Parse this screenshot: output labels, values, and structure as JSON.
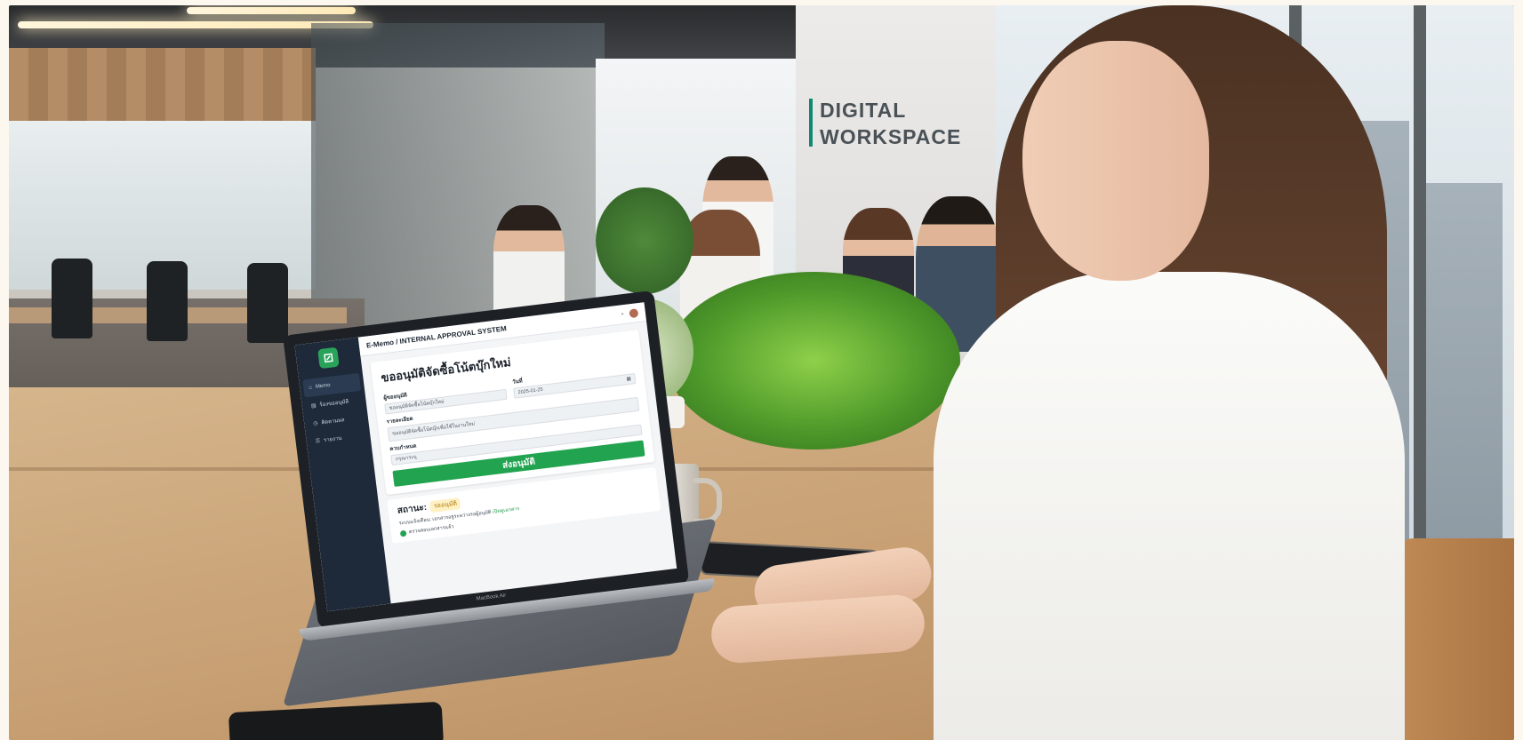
{
  "scene": {
    "wall_sign": {
      "line1": "DIGITAL",
      "line2": "WORKSPACE"
    }
  },
  "laptop": {
    "brand_label": "MacBook Air",
    "app": {
      "title": "E-Memo / INTERNAL APPROVAL SYSTEM",
      "sidebar": {
        "items": [
          {
            "label": "Memo",
            "icon": "home-icon",
            "active": true
          },
          {
            "label": "ร้องขออนุมัติ",
            "icon": "document-icon",
            "active": false
          },
          {
            "label": "ติดตามผล",
            "icon": "clock-icon",
            "active": false
          },
          {
            "label": "รายงาน",
            "icon": "list-icon",
            "active": false
          }
        ]
      },
      "form": {
        "heading": "ขออนุมัติจัดซื้อโน้ตบุ๊กใหม่",
        "requester_label": "ผู้ขออนุมัติ",
        "requester_value": "ขออนุมัติจัดซื้อโน้ตบุ๊กใหม่",
        "date_label": "วันที่",
        "date_value": "2025-01-25",
        "details_label": "รายละเอียด",
        "details_value": "ขออนุมัติจัดซื้อโน้ตบุ๊กเพื่อใช้ในงานใหม่",
        "deadline_label": "ควบกำหนด",
        "deadline_value": "กรุณาระบุ",
        "submit_label": "ส่งอนุมัติ"
      },
      "status": {
        "label": "สถานะ:",
        "badge": "รออนุมัติ",
        "description": "ระบบแจ้งเตือน: เอกสารอยู่ระหว่างรอผู้อนุมัติ",
        "description_highlight": "เปิดดูเอกสาร",
        "check_item": "ตรวจสอบเอกสารแล้ว"
      }
    }
  },
  "colors": {
    "sidebar": "#1e2a3a",
    "accent_green": "#22a34f",
    "badge_bg": "#fff1c4",
    "badge_text": "#b07a09"
  }
}
